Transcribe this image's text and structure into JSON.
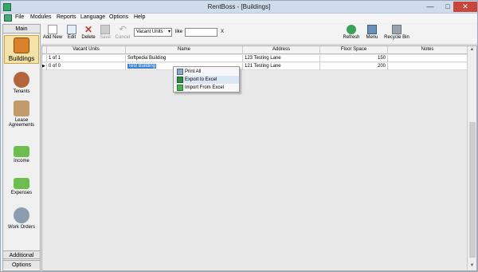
{
  "window": {
    "title": "RentBoss - [Buildings]",
    "min": "—",
    "max": "□",
    "close": "✕"
  },
  "menu": [
    "File",
    "Modules",
    "Reports",
    "Language",
    "Options",
    "Help"
  ],
  "sidebar": {
    "main_header": "Main",
    "items": [
      {
        "label": "Buildings",
        "icon": "buildings-icon",
        "selected": true
      },
      {
        "label": "Tenants",
        "icon": "tenants-icon"
      },
      {
        "label": "Lease Agreements",
        "icon": "lease-icon"
      },
      {
        "label": "Income",
        "icon": "income-icon"
      },
      {
        "label": "Expenses",
        "icon": "expenses-icon"
      },
      {
        "label": "Work Orders",
        "icon": "wrench-icon"
      }
    ],
    "additional": "Additional",
    "options": "Options"
  },
  "toolbar": {
    "add": "Add New",
    "edit": "Edit",
    "delete": "Delete",
    "save": "Save",
    "cancel": "Cancel",
    "filter_field": "Vacant Units",
    "filter_op": "like",
    "filter_value": "",
    "clear": "X",
    "refresh": "Refresh",
    "menu": "Menu",
    "recycle": "Recycle Bin"
  },
  "grid": {
    "columns": [
      "Vacant Units",
      "Name",
      "Address",
      "Floor Space",
      "Notes"
    ],
    "rows": [
      {
        "marker": "",
        "vacant": "1 of 1",
        "name": "Softpedia Building",
        "address": "123 Testing Lane",
        "floor": "150",
        "notes": ""
      },
      {
        "marker": "▶",
        "vacant": "0 of 0",
        "name": "Test Building",
        "address": "121 Testing Lane",
        "floor": "200",
        "notes": ""
      }
    ]
  },
  "context_menu": [
    "Print All",
    "Export to Excel",
    "Import From Excel"
  ]
}
